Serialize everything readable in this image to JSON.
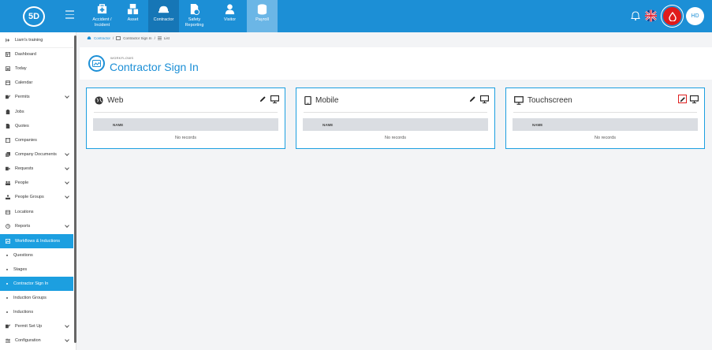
{
  "logo": "5D",
  "modules": [
    {
      "label_1": "Accident /",
      "label_2": "Incident",
      "icon": "first-aid-kit-icon"
    },
    {
      "label_1": "Asset",
      "label_2": "",
      "icon": "boxes-icon"
    },
    {
      "label_1": "Contractor",
      "label_2": "",
      "icon": "hard-hat-icon"
    },
    {
      "label_1": "Safety",
      "label_2": "Reporting",
      "icon": "safety-report-icon"
    },
    {
      "label_1": "Visitor",
      "label_2": "",
      "icon": "person-icon"
    },
    {
      "label_1": "Payroll",
      "label_2": "",
      "icon": "coins-icon"
    }
  ],
  "user_initials": "HD",
  "sidebar": {
    "items": [
      {
        "label": "Liam's training"
      },
      {
        "label": "Dashboard"
      },
      {
        "label": "Today"
      },
      {
        "label": "Calendar"
      },
      {
        "label": "Permits"
      },
      {
        "label": "Jobs"
      },
      {
        "label": "Quotes"
      },
      {
        "label": "Companies"
      },
      {
        "label": "Company Documents"
      },
      {
        "label": "Requests"
      },
      {
        "label": "People"
      },
      {
        "label": "People Groups"
      },
      {
        "label": "Locations"
      },
      {
        "label": "Reports"
      },
      {
        "label": "Workflows & Inductions"
      },
      {
        "label": "Questions"
      },
      {
        "label": "Stages"
      },
      {
        "label": "Contractor Sign In"
      },
      {
        "label": "Induction Groups"
      },
      {
        "label": "Inductions"
      },
      {
        "label": "Permit Set Up"
      },
      {
        "label": "Configuration"
      }
    ]
  },
  "breadcrumb": {
    "item1": "Contractor",
    "item2": "Contractor Sign In",
    "item3": "List"
  },
  "header": {
    "supertitle": "WORKFLOWS",
    "title": "Contractor Sign In"
  },
  "cards": [
    {
      "title": "Web",
      "column": "NAME",
      "empty": "No records"
    },
    {
      "title": "Mobile",
      "column": "NAME",
      "empty": "No records"
    },
    {
      "title": "Touchscreen",
      "column": "NAME",
      "empty": "No records"
    }
  ]
}
